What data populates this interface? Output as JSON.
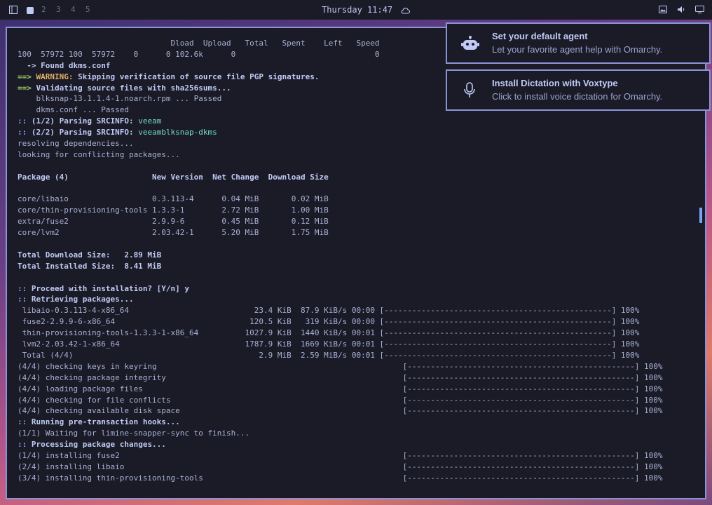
{
  "topbar": {
    "workspaces": [
      "2",
      "3",
      "4",
      "5"
    ],
    "clock": "Thursday 11:47"
  },
  "notifications": [
    {
      "title": "Set your default agent",
      "body": "Let your favorite agent help with Omarchy.",
      "icon": "robot-icon"
    },
    {
      "title": "Install Dictation with Voxtype",
      "body": "Click to install voice dictation for Omarchy.",
      "icon": "microphone-icon"
    }
  ],
  "terminal": {
    "lines": [
      "                                 Dload  Upload   Total   Spent    Left   Speed",
      "100  57972 100  57972    0      0 102.6k      0                              0",
      "  -> Found dkms.conf",
      "==> WARNING: Skipping verification of source file PGP signatures.",
      "==> Validating source files with sha256sums...",
      "    blksnap-13.1.1.4-1.noarch.rpm ... Passed",
      "    dkms.conf ... Passed",
      ":: (1/2) Parsing SRCINFO: veeam",
      ":: (2/2) Parsing SRCINFO: veeamblksnap-dkms",
      "resolving dependencies...",
      "looking for conflicting packages...",
      "",
      "Package (4)                  New Version  Net Change  Download Size",
      "",
      "core/libaio                  0.3.113-4      0.04 MiB       0.02 MiB",
      "core/thin-provisioning-tools 1.3.3-1        2.72 MiB       1.00 MiB",
      "extra/fuse2                  2.9.9-6        0.45 MiB       0.12 MiB",
      "core/lvm2                    2.03.42-1      5.20 MiB       1.75 MiB",
      "",
      "Total Download Size:   2.89 MiB",
      "Total Installed Size:  8.41 MiB",
      "",
      ":: Proceed with installation? [Y/n] y",
      ":: Retrieving packages...",
      " libaio-0.3.113-4-x86_64                           23.4 KiB  87.9 KiB/s 00:00 [-------------------------------------------------] 100%",
      " fuse2-2.9.9-6-x86_64                             120.5 KiB   319 KiB/s 00:00 [-------------------------------------------------] 100%",
      " thin-provisioning-tools-1.3.3-1-x86_64          1027.9 KiB  1440 KiB/s 00:01 [-------------------------------------------------] 100%",
      " lvm2-2.03.42-1-x86_64                           1787.9 KiB  1669 KiB/s 00:01 [-------------------------------------------------] 100%",
      " Total (4/4)                                        2.9 MiB  2.59 MiB/s 00:01 [-------------------------------------------------] 100%",
      "(4/4) checking keys in keyring                                                     [-------------------------------------------------] 100%",
      "(4/4) checking package integrity                                                   [-------------------------------------------------] 100%",
      "(4/4) loading package files                                                        [-------------------------------------------------] 100%",
      "(4/4) checking for file conflicts                                                  [-------------------------------------------------] 100%",
      "(4/4) checking available disk space                                                [-------------------------------------------------] 100%",
      ":: Running pre-transaction hooks...",
      "(1/1) Waiting for limine-snapper-sync to finish...",
      ":: Processing package changes...",
      "(1/4) installing fuse2                                                             [-------------------------------------------------] 100%",
      "(2/4) installing libaio                                                            [-------------------------------------------------] 100%",
      "(3/4) installing thin-provisioning-tools                                           [-------------------------------------------------] 100%"
    ],
    "line_styles": [
      "",
      "",
      "b",
      "yellow",
      "green",
      "",
      "",
      "blue",
      "blue",
      "",
      "",
      "",
      "b",
      "",
      "",
      "",
      "",
      "",
      "",
      "b",
      "b",
      "",
      "b",
      "b",
      "",
      "",
      "",
      "",
      "",
      "",
      "",
      "",
      "",
      "",
      "b",
      "",
      "b",
      "",
      "",
      ""
    ]
  }
}
